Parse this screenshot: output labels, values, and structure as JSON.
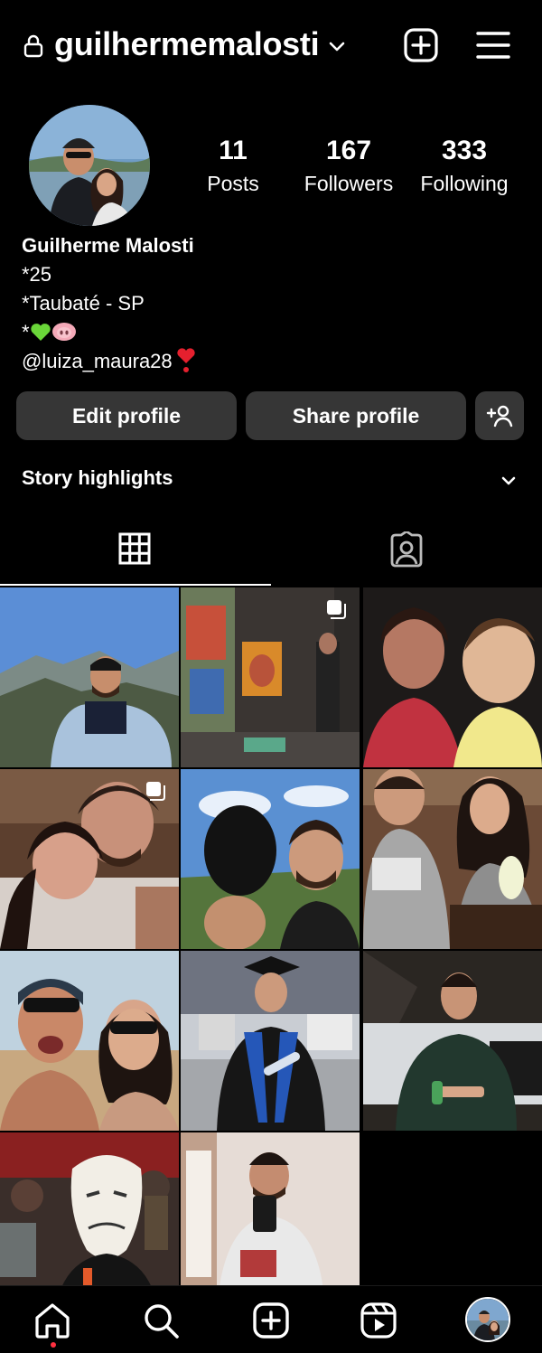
{
  "header": {
    "username": "guilhermemalosti",
    "lock_icon": "lock-icon",
    "switch_icon": "chevron-down-icon",
    "create_icon": "plus-square-icon",
    "menu_icon": "hamburger-menu-icon"
  },
  "profile": {
    "avatar_icon": "avatar",
    "stats": [
      {
        "value": "11",
        "label": "Posts"
      },
      {
        "value": "167",
        "label": "Followers"
      },
      {
        "value": "333",
        "label": "Following"
      }
    ],
    "name": "Guilherme Malosti",
    "bio_lines": [
      "*25",
      "*Taubaté - SP",
      "*"
    ],
    "mention": "@luiza_maura28"
  },
  "actions": {
    "edit_label": "Edit profile",
    "share_label": "Share profile",
    "add_user_icon": "add-person-icon"
  },
  "highlights": {
    "label": "Story highlights",
    "chevron_icon": "chevron-down-icon"
  },
  "tabs": [
    {
      "name": "grid",
      "icon": "grid-icon",
      "selected": true
    },
    {
      "name": "tagged",
      "icon": "tagged-person-icon",
      "selected": false
    }
  ],
  "posts": [
    {
      "id": 1,
      "multi": false
    },
    {
      "id": 2,
      "multi": true
    },
    {
      "id": 3,
      "multi": false
    },
    {
      "id": 4,
      "multi": true
    },
    {
      "id": 5,
      "multi": false
    },
    {
      "id": 6,
      "multi": false
    },
    {
      "id": 7,
      "multi": false
    },
    {
      "id": 8,
      "multi": false
    },
    {
      "id": 9,
      "multi": false
    },
    {
      "id": 10,
      "multi": false
    },
    {
      "id": 11,
      "multi": false
    }
  ],
  "bottom_nav": [
    {
      "icon": "home-icon",
      "active": true
    },
    {
      "icon": "search-icon",
      "active": false
    },
    {
      "icon": "create-icon",
      "active": false
    },
    {
      "icon": "reels-icon",
      "active": false
    },
    {
      "icon": "profile-avatar-icon",
      "active": false
    }
  ],
  "colors": {
    "background": "#000000",
    "button": "#363636",
    "text": "#ffffff",
    "notification_dot": "#ff3040",
    "heart_green": "#6ad639",
    "heart_red": "#e5202e"
  }
}
